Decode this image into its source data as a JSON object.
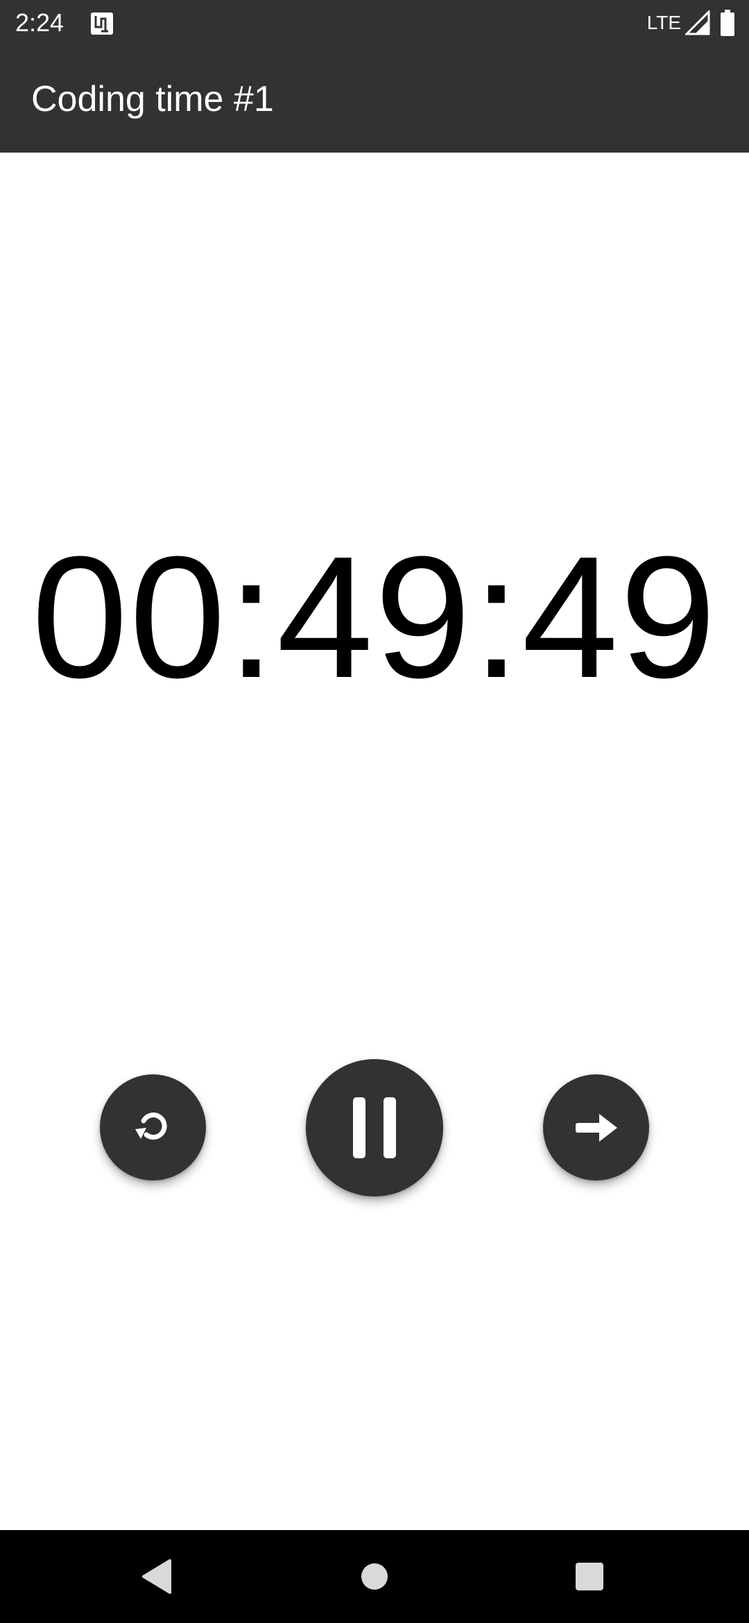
{
  "status_bar": {
    "time": "2:24",
    "network": "LTE",
    "icons": [
      "notification-app-icon",
      "signal-icon",
      "battery-icon"
    ]
  },
  "app_bar": {
    "title": "Coding time #1"
  },
  "timer": {
    "display": "00:49:49"
  },
  "controls": {
    "reset_icon": "reset-icon",
    "pause_icon": "pause-icon",
    "next_icon": "arrow-right-icon"
  },
  "nav_bar": {
    "icons": [
      "back-icon",
      "home-icon",
      "recents-icon"
    ]
  },
  "colors": {
    "bar_background": "#323232",
    "fab_background": "#323232",
    "nav_background": "#000000",
    "page_background": "#ffffff",
    "timer_text": "#000000"
  }
}
